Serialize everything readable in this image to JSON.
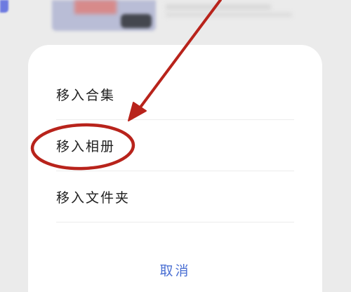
{
  "menu": {
    "items": [
      {
        "label": "移入合集"
      },
      {
        "label": "移入相册"
      },
      {
        "label": "移入文件夹"
      }
    ],
    "cancel_label": "取消"
  },
  "colors": {
    "accent": "#4a6fd3",
    "annotation": "#b8231b",
    "overlay": "#ebebeb"
  },
  "annotation": {
    "highlighted_item": "移入相册"
  }
}
